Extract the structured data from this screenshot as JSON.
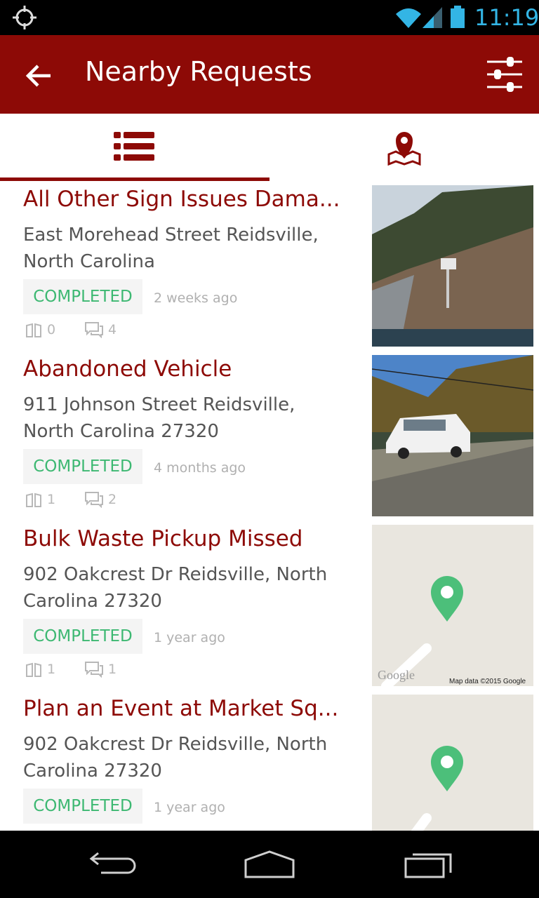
{
  "status_bar": {
    "time": "11:19"
  },
  "app_bar": {
    "title": "Nearby Requests"
  },
  "tabs": [
    {
      "icon": "list-icon",
      "selected": true
    },
    {
      "icon": "map-icon",
      "selected": false
    }
  ],
  "colors": {
    "brand": "#8d0a06",
    "status_completed": "#3db872",
    "status_bar_accent": "#33b5e5"
  },
  "requests": [
    {
      "title": "All Other Sign Issues Dama...",
      "address": "East Morehead Street Reidsville, North Carolina",
      "status": "COMPLETED",
      "time": "2 weeks ago",
      "votes": "0",
      "comments": "4",
      "thumb": "photo"
    },
    {
      "title": "Abandoned Vehicle",
      "address": "911  Johnson Street Reidsville, North Carolina 27320",
      "status": "COMPLETED",
      "time": "4 months ago",
      "votes": "1",
      "comments": "2",
      "thumb": "photo"
    },
    {
      "title": "Bulk Waste Pickup Missed",
      "address": "902  Oakcrest Dr Reidsville, North Carolina 27320",
      "status": "COMPLETED",
      "time": "1 year ago",
      "votes": "1",
      "comments": "1",
      "thumb": "map",
      "map_logo": "Google",
      "map_attribution": "Map data ©2015 Google"
    },
    {
      "title": "Plan an Event at Market Sq...",
      "address": "902  Oakcrest Dr Reidsville, North Carolina 27320",
      "status": "COMPLETED",
      "time": "1 year ago",
      "votes": "",
      "comments": "",
      "thumb": "map"
    }
  ]
}
